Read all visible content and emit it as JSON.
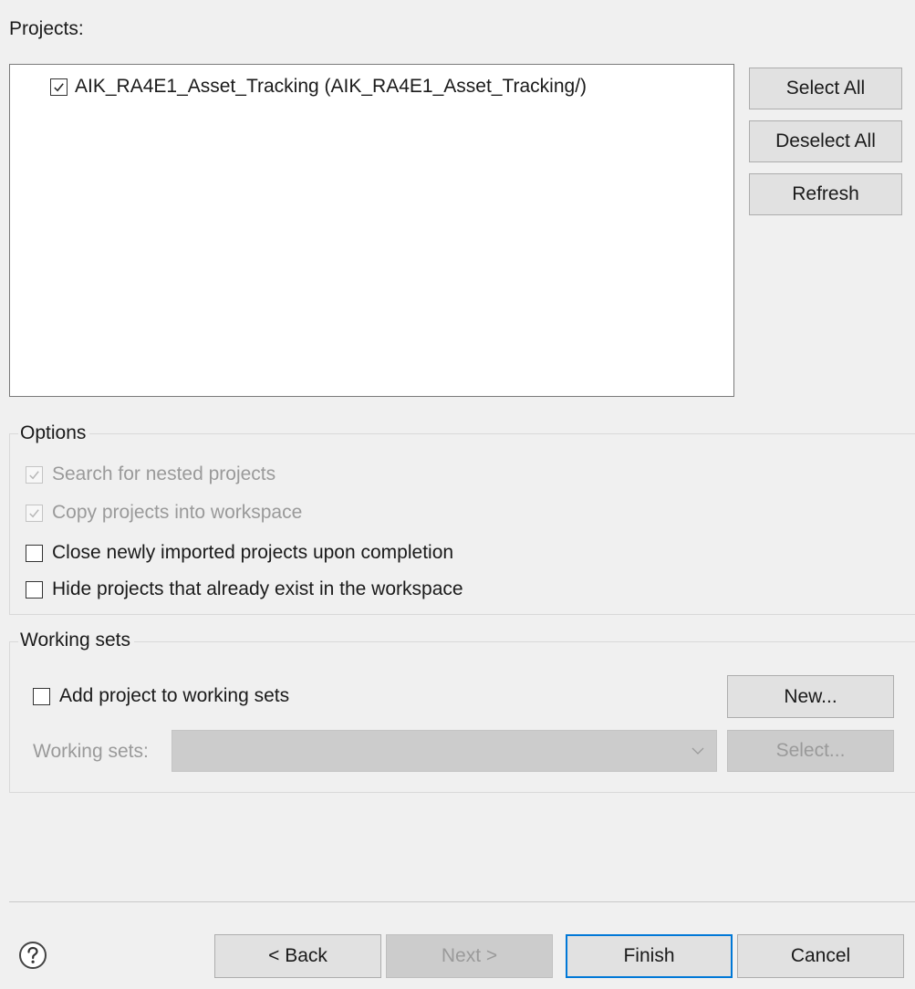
{
  "projects": {
    "label": "Projects:",
    "items": [
      {
        "label": "AIK_RA4E1_Asset_Tracking (AIK_RA4E1_Asset_Tracking/)",
        "checked": true
      }
    ],
    "buttons": {
      "select_all": "Select All",
      "deselect_all": "Deselect All",
      "refresh": "Refresh"
    }
  },
  "options": {
    "title": "Options",
    "search_nested": "Search for nested projects",
    "copy_into_workspace": "Copy projects into workspace",
    "close_imported": "Close newly imported projects upon completion",
    "hide_existing": "Hide projects that already exist in the workspace"
  },
  "working_sets": {
    "title": "Working sets",
    "add_to_sets": "Add project to working sets",
    "new_button": "New...",
    "sets_label": "Working sets:",
    "select_button": "Select..."
  },
  "footer": {
    "back": "< Back",
    "next": "Next >",
    "finish": "Finish",
    "cancel": "Cancel"
  },
  "icons": {
    "help": "help-icon",
    "check": "check-icon",
    "dropdown": "chevron-down-icon"
  },
  "colors": {
    "accent": "#0078d7",
    "dialog_bg": "#f0f0f0"
  }
}
